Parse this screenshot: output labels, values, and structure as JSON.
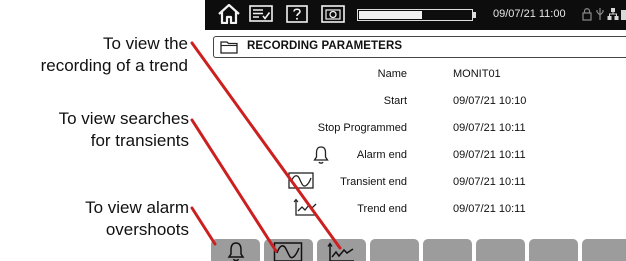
{
  "annotations": {
    "trend": [
      "To view the",
      "recording of a trend"
    ],
    "transients": [
      "To view searches",
      "for transients"
    ],
    "alarms": [
      "To view alarm",
      "overshoots"
    ]
  },
  "status_bar": {
    "datetime": "09/07/21 11:00",
    "battery_level": 0.55,
    "icons": [
      "home-icon",
      "menu-icon",
      "help-icon",
      "camera-icon",
      "lock-icon",
      "usb-icon",
      "network-icon",
      "signal-icon"
    ]
  },
  "panel": {
    "title": "RECORDING PARAMETERS",
    "rows": [
      {
        "label": "Name",
        "value": "MONIT01"
      },
      {
        "label": "Start",
        "value": "09/07/21 10:10"
      },
      {
        "label": "Stop Programmed",
        "value": "09/07/21 10:11"
      },
      {
        "label": "Alarm end",
        "value": "09/07/21 10:11",
        "icon": "bell-icon"
      },
      {
        "label": "Transient end",
        "value": "09/07/21 10:11",
        "icon": "transient-icon"
      },
      {
        "label": "Trend end",
        "value": "09/07/21 10:11",
        "icon": "trend-icon"
      }
    ]
  },
  "softkeys": [
    "alarm-key",
    "transient-key",
    "trend-key",
    "empty",
    "empty",
    "empty",
    "empty",
    "empty"
  ],
  "colors": {
    "leader_line": "#cc2020",
    "status_bar": "#0d0d0d",
    "softkey": "#9c9c9c"
  }
}
